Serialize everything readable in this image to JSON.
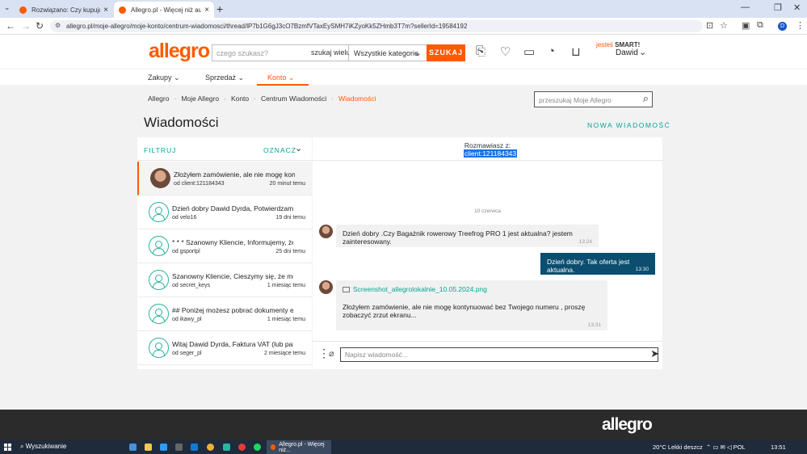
{
  "browser": {
    "tabs": [
      {
        "title": "Rozwiązano: Czy kupujący pot..."
      },
      {
        "title": "Allegro.pl - Więcej niż aukcje. N..."
      }
    ],
    "url": "allegro.pl/moje-allegro/moje-konto/centrum-wiadomosci/thread/lP7b1G6gJ3cO7BzmfVTaxEySMH7iKZyoKk5ZHmb3T7m?sellerId=19584192",
    "profile_initial": "D"
  },
  "header": {
    "logo": "allegro",
    "search_placeholder": "czego szukasz?",
    "search_many": "szukaj wielu",
    "category": "Wszystkie kategorie",
    "search_button": "SZUKAJ",
    "smart_prefix": "jesteś",
    "smart_label": "SMART!",
    "user_name": "Dawid"
  },
  "menu": [
    {
      "label": "Zakupy"
    },
    {
      "label": "Sprzedaż"
    },
    {
      "label": "Konto"
    }
  ],
  "breadcrumb": [
    "Allegro",
    "Moje Allegro",
    "Konto",
    "Centrum Wiadomości",
    "Wiadomości"
  ],
  "msg_search_placeholder": "przeszukaj Moje Allegro",
  "page_title": "Wiadomości",
  "new_message": "NOWA WIADOMOŚĆ",
  "filter": {
    "filtruj": "FILTRUJ",
    "oznacz": "OZNACZ"
  },
  "conversations": [
    {
      "subject": "Złożyłem zamówienie, ale nie mogę konty...",
      "from": "od client:121184343",
      "time": "20 minut temu"
    },
    {
      "subject": "Dzień dobry Dawid Dyrda, Potwierdzam s...",
      "from": "od velo16",
      "time": "19 dni temu"
    },
    {
      "subject": "* * * Szanowny Kliencie, Informujemy, że ...",
      "from": "od gsportpl",
      "time": "25 dni temu"
    },
    {
      "subject": "Szanowny Kliencie, Cieszymy się, że mogli...",
      "from": "od secret_keys",
      "time": "1 miesiąc temu"
    },
    {
      "subject": "## Poniżej możesz pobrać dokumenty ele...",
      "from": "od ikawy_pl",
      "time": "1 miesiąc temu"
    },
    {
      "subject": "Witaj Dawid Dyrda, Faktura VAT (lub para...",
      "from": "od seger_pl",
      "time": "2 miesiące temu"
    }
  ],
  "chat": {
    "talking_with": "Rozmawiasz z:",
    "client": "client:121184343",
    "date": "10 czerwca",
    "messages": [
      {
        "text": "Dzień dobry .Czy Bagażnik rowerowy Treefrog PRO 1 jest aktualna? jestem zainteresowany.",
        "time": "13:24"
      },
      {
        "text": "Dzień dobry. Tak oferta jest aktualna.",
        "time": "13:30"
      },
      {
        "attachment": "Screenshot_allegrolokalnie_10.05.2024.png",
        "text": "Złożyłem zamówienie, ale nie mogę kontynuować bez Twojego numeru , proszę zobaczyć zrzut ekranu...",
        "time": "13:31"
      }
    ],
    "compose_placeholder": "Napisz wiadomość..."
  },
  "footer_logo": "allegro",
  "taskbar": {
    "search": "Wyszukiwanie",
    "active_app": "Allegro.pl - Więcej niż...",
    "weather": "20°C  Lekki deszcz",
    "lang": "POL",
    "time": "13:51"
  }
}
